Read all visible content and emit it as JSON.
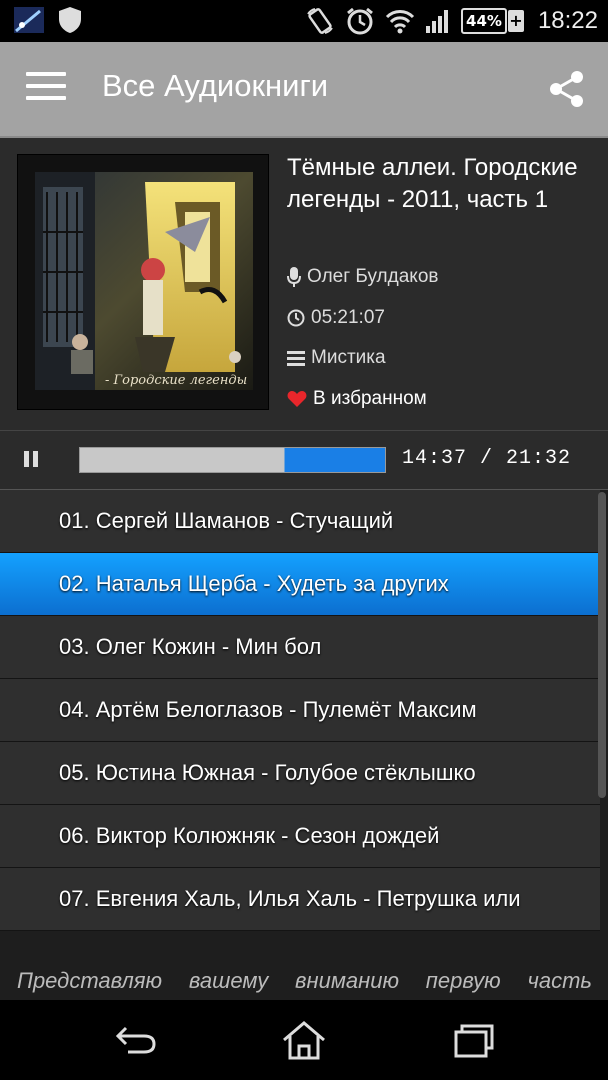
{
  "status_bar": {
    "time": "18:22",
    "battery": "44%",
    "icons": [
      "app-icon",
      "shield-icon",
      "rotate-icon",
      "alarm-icon",
      "wifi-icon",
      "signal-icon",
      "battery-icon"
    ]
  },
  "app_bar": {
    "title": "Все Аудиокниги"
  },
  "book": {
    "title": "Тёмные аллеи. Городские легенды - 2011, часть 1",
    "narrator": "Олег Булдаков",
    "duration": "05:21:07",
    "genre": "Мистика",
    "favorite_label": "В избранном",
    "cover_caption": "- Городские легенды"
  },
  "player": {
    "time": "14:37 / 21:32",
    "progress": 0.67
  },
  "tracks": [
    {
      "label": "01. Сергей Шаманов - Стучащий"
    },
    {
      "label": "02. Наталья Щерба - Худеть за других"
    },
    {
      "label": "03. Олег Кожин - Мин бол"
    },
    {
      "label": "04. Артём Белоглазов - Пулемёт Максим"
    },
    {
      "label": "05. Юстина Южная - Голубое стёклышко"
    },
    {
      "label": "06. Виктор Колюжняк - Сезон дождей"
    },
    {
      "label": "07. Евгения Халь, Илья Халь - Петрушка или"
    }
  ],
  "selected_track": 1,
  "description": "Представляю вашему вниманию первую часть",
  "colors": {
    "accent": "#0f8ef0",
    "app_bar": "#a3a3a3",
    "heart": "#e8262b"
  }
}
